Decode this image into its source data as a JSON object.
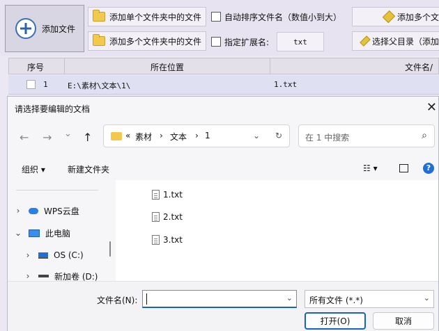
{
  "toolbar": {
    "add_file": "添加文件",
    "add_single_folder": "添加单个文件夹中的文件",
    "add_multi_folder": "添加多个文件夹中的文件",
    "auto_sort": "自动排序文件名（数值小到大）",
    "specify_ext": "指定扩展名:",
    "ext_value": "txt",
    "add_multi_right": "添加多个文",
    "select_parent": "选择父目录（添加"
  },
  "table": {
    "headers": [
      "序号",
      "所在位置",
      "文件名/"
    ],
    "rows": [
      {
        "index": "1",
        "location": "E:\\素材\\文本\\1\\",
        "filename": "1.txt"
      }
    ]
  },
  "dialog": {
    "title": "请选择要编辑的文档",
    "close_glyph": "✕",
    "nav": {
      "back": "←",
      "forward": "→",
      "recent": "⌄",
      "up": "↑"
    },
    "breadcrumb": {
      "overflow": "«",
      "parts": [
        "素材",
        "文本",
        "1"
      ],
      "sep": "›",
      "dropdown": "⌄",
      "refresh": "↻"
    },
    "search_placeholder": "在 1 中搜索",
    "commands": {
      "organize": "组织 ▾",
      "new_folder": "新建文件夹",
      "view": "☷ ▾",
      "help": "?"
    },
    "tree": [
      {
        "chevron": "›",
        "label": "WPS云盘",
        "icon": "cloud-icon"
      },
      {
        "chevron": "⌄",
        "label": "此电脑",
        "icon": "computer-icon"
      },
      {
        "chevron": "›",
        "label": "OS (C:)",
        "icon": "windows-drive-icon"
      },
      {
        "chevron": "›",
        "label": "新加卷 (D:)",
        "icon": "drive-icon"
      }
    ],
    "files": [
      "1.txt",
      "2.txt",
      "3.txt"
    ],
    "filename_label": "文件名(N):",
    "filename_value": "",
    "filetype_value": "所有文件 (*.*)",
    "open_button": "打开(O)",
    "cancel_button": "取消"
  },
  "colors": {
    "accent": "#1a5fc4",
    "folder": "#f2c94c"
  }
}
